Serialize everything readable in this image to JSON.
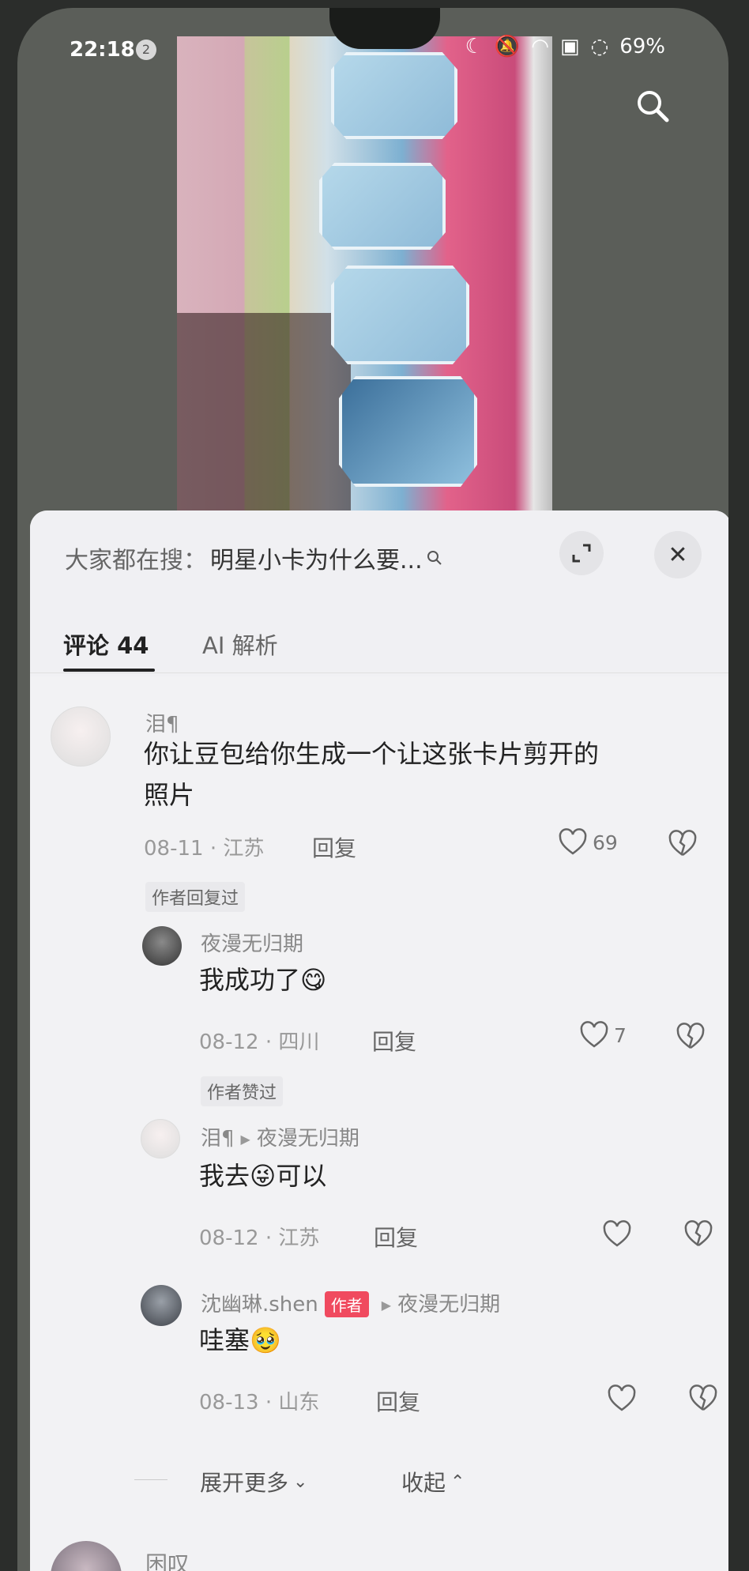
{
  "status_bar": {
    "time": "22:18",
    "notif_count": "2",
    "battery": "69%"
  },
  "search_bar": {
    "prefix": "大家都在搜：",
    "query": "明星小卡为什么要..."
  },
  "tabs": [
    {
      "label": "评论 44"
    },
    {
      "label": "AI 解析"
    }
  ],
  "comments": [
    {
      "name": "泪¶",
      "text_line1": "你让豆包给你生成一个让这张卡片剪开的",
      "text_line2": "照片",
      "date": "08-11",
      "region": "江苏",
      "reply": "回复",
      "likes": "69",
      "tag": "作者回复过"
    },
    {
      "name": "夜漫无归期",
      "text": "我成功了",
      "emoji": "😋",
      "date": "08-12",
      "region": "四川",
      "reply": "回复",
      "likes": "7",
      "tag": "作者赞过"
    },
    {
      "name": "泪¶",
      "reply_to": "夜漫无归期",
      "text_a": "我去",
      "emoji": "😜",
      "text_b": "可以",
      "date": "08-12",
      "region": "江苏",
      "reply": "回复"
    },
    {
      "name": "沈幽琳.shen",
      "badge": "作者",
      "reply_to": "夜漫无归期",
      "text": "哇塞",
      "emoji": "🥹",
      "date": "08-13",
      "region": "山东",
      "reply": "回复"
    }
  ],
  "footer": {
    "expand_more": "展开更多",
    "collapse": "收起"
  },
  "next_comment": {
    "name": "困叹"
  }
}
